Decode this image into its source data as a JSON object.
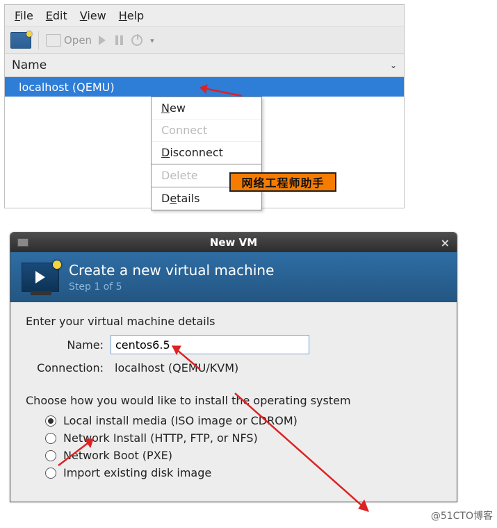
{
  "menubar": {
    "file": "File",
    "edit": "Edit",
    "view": "View",
    "help": "Help"
  },
  "toolbar": {
    "open_label": "Open"
  },
  "list": {
    "header": "Name",
    "selected": "localhost (QEMU)"
  },
  "ctx_menu": {
    "new": "New",
    "connect": "Connect",
    "disconnect": "Disconnect",
    "delete": "Delete",
    "details": "Details"
  },
  "badge_text": "网络工程师助手",
  "dialog": {
    "title": "New VM",
    "header_title": "Create a new virtual machine",
    "step": "Step 1 of 5",
    "details_label": "Enter your virtual machine details",
    "name_label": "Name:",
    "name_value": "centos6.5",
    "connection_label": "Connection:",
    "connection_value": "localhost (QEMU/KVM)",
    "choose_label": "Choose how you would like to install the operating system",
    "options": {
      "local": "Local install media (ISO image or CDROM)",
      "net_install": "Network Install (HTTP, FTP, or NFS)",
      "net_boot": "Network Boot (PXE)",
      "import": "Import existing disk image"
    }
  },
  "watermark": "@51CTO博客"
}
